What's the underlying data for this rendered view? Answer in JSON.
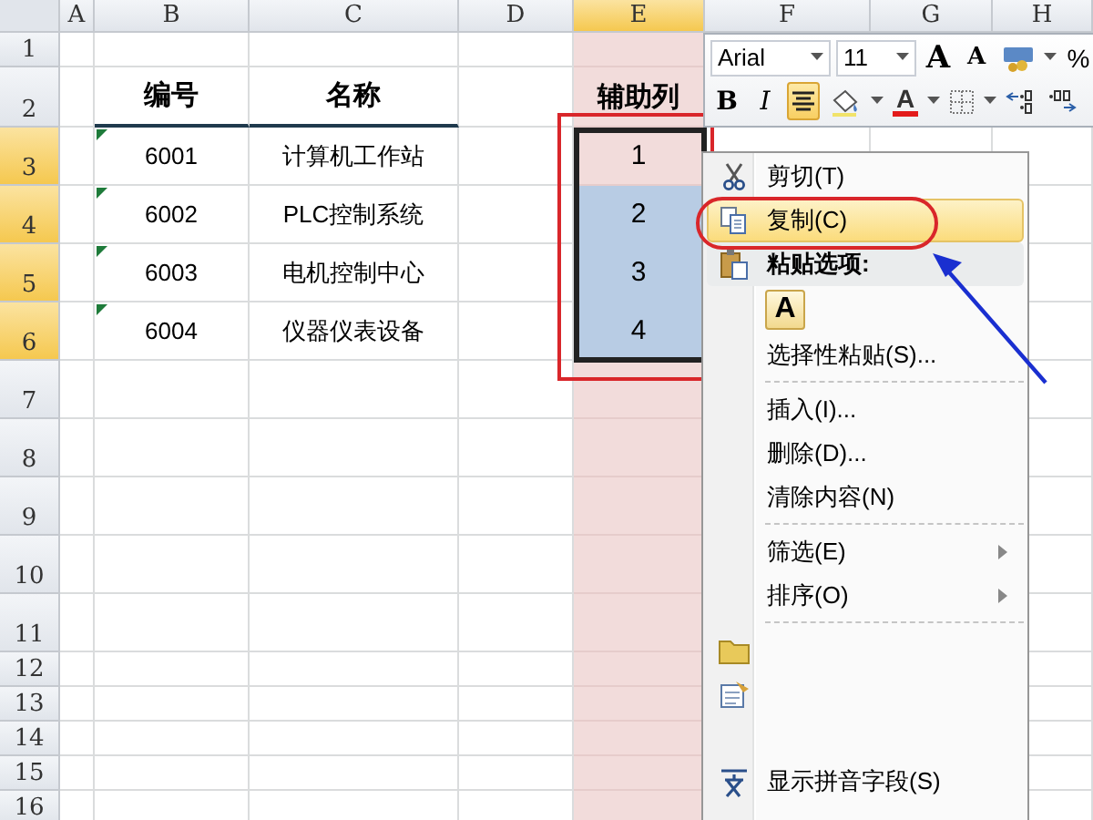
{
  "sheet": {
    "columns": [
      {
        "label": "A",
        "selected": false
      },
      {
        "label": "B",
        "selected": false
      },
      {
        "label": "C",
        "selected": false
      },
      {
        "label": "D",
        "selected": false
      },
      {
        "label": "E",
        "selected": true
      },
      {
        "label": "F",
        "selected": false
      },
      {
        "label": "G",
        "selected": false
      },
      {
        "label": "H",
        "selected": false
      }
    ],
    "rows": [
      {
        "label": "1",
        "selected": false
      },
      {
        "label": "2",
        "selected": false
      },
      {
        "label": "3",
        "selected": true
      },
      {
        "label": "4",
        "selected": true
      },
      {
        "label": "5",
        "selected": true
      },
      {
        "label": "6",
        "selected": true
      },
      {
        "label": "7",
        "selected": false
      },
      {
        "label": "8",
        "selected": false
      },
      {
        "label": "9",
        "selected": false
      },
      {
        "label": "10",
        "selected": false
      },
      {
        "label": "11",
        "selected": false
      },
      {
        "label": "12",
        "selected": false
      },
      {
        "label": "13",
        "selected": false
      },
      {
        "label": "14",
        "selected": false
      },
      {
        "label": "15",
        "selected": false
      },
      {
        "label": "16",
        "selected": false
      }
    ],
    "header_row": {
      "number": "编号",
      "name": "名称",
      "helper": "辅助列"
    },
    "records": [
      {
        "number": "6001",
        "name": "计算机工作站",
        "helper": "1",
        "flagged": true,
        "highlighted": false
      },
      {
        "number": "6002",
        "name": "PLC控制系统",
        "helper": "2",
        "flagged": true,
        "highlighted": true
      },
      {
        "number": "6003",
        "name": "电机控制中心",
        "helper": "3",
        "flagged": true,
        "highlighted": true
      },
      {
        "number": "6004",
        "name": "仪器仪表设备",
        "helper": "4",
        "flagged": true,
        "highlighted": true
      }
    ]
  },
  "mini_toolbar": {
    "font": "Arial",
    "size": "11",
    "row1": [
      {
        "kind": "grow",
        "label": "A"
      },
      {
        "kind": "shrink",
        "label": "A"
      },
      {
        "kind": "currency"
      },
      {
        "kind": "percent",
        "label": "%"
      }
    ],
    "row2": [
      {
        "kind": "bold",
        "label": "B",
        "selected": false
      },
      {
        "kind": "italic",
        "label": "I",
        "selected": false
      },
      {
        "kind": "center",
        "selected": true
      },
      {
        "kind": "fill",
        "selected": false
      },
      {
        "kind": "font_color",
        "label": "A",
        "selected": false
      },
      {
        "kind": "borders",
        "selected": false
      },
      {
        "kind": "inc_decimal",
        "selected": false
      },
      {
        "kind": "dec_decimal",
        "selected": false
      }
    ]
  },
  "context_menu": [
    {
      "kind": "item",
      "label": "剪切(T)",
      "selected": false
    },
    {
      "kind": "item",
      "label": "复制(C)",
      "selected": true
    },
    {
      "kind": "header",
      "label": "粘贴选项:"
    },
    {
      "kind": "paste_options",
      "label": "A"
    },
    {
      "kind": "item",
      "label": "选择性粘贴(S)...",
      "selected": false
    },
    {
      "kind": "separator"
    },
    {
      "kind": "item",
      "label": "插入(I)...",
      "selected": false
    },
    {
      "kind": "item",
      "label": "删除(D)...",
      "selected": false
    },
    {
      "kind": "item",
      "label": "清除内容(N)",
      "selected": false
    },
    {
      "kind": "separator"
    },
    {
      "kind": "item",
      "label": "筛选(E)",
      "submenu": true,
      "selected": false
    },
    {
      "kind": "item",
      "label": "排序(O)",
      "submenu": true,
      "selected": false
    },
    {
      "kind": "separator"
    },
    {
      "kind": "item",
      "selected": false
    },
    {
      "kind": "item",
      "selected": false
    },
    {
      "kind": "blank"
    },
    {
      "kind": "item",
      "label": "显示拼音字段(S)",
      "selected": false
    }
  ],
  "annotations": [
    {
      "kind": "box"
    },
    {
      "kind": "oval"
    },
    {
      "kind": "arrow"
    }
  ]
}
